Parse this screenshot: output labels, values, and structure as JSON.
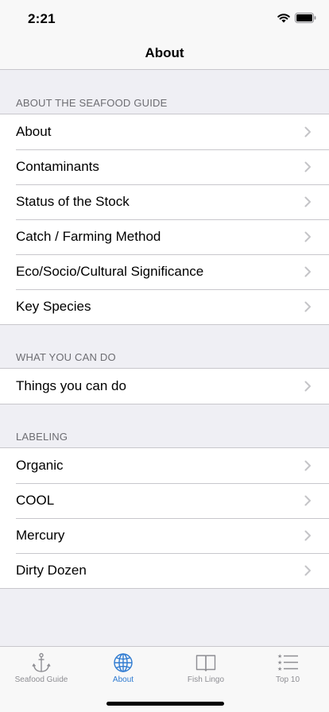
{
  "status_bar": {
    "time": "2:21"
  },
  "nav": {
    "title": "About"
  },
  "sections": [
    {
      "header": "ABOUT THE SEAFOOD GUIDE",
      "rows": [
        "About",
        "Contaminants",
        "Status of the Stock",
        "Catch / Farming Method",
        "Eco/Socio/Cultural Significance",
        "Key Species"
      ]
    },
    {
      "header": "WHAT YOU CAN DO",
      "rows": [
        "Things you can do"
      ]
    },
    {
      "header": "LABELING",
      "rows": [
        "Organic",
        "COOL",
        "Mercury",
        "Dirty Dozen"
      ]
    }
  ],
  "tabs": [
    {
      "label": "Seafood Guide",
      "icon": "anchor-icon"
    },
    {
      "label": "About",
      "icon": "globe-icon",
      "active": true
    },
    {
      "label": "Fish Lingo",
      "icon": "book-icon"
    },
    {
      "label": "Top 10",
      "icon": "star-list-icon"
    }
  ],
  "colors": {
    "accent": "#2f7bd1",
    "inactive_tab": "#8e8e93",
    "background": "#efeff4"
  }
}
